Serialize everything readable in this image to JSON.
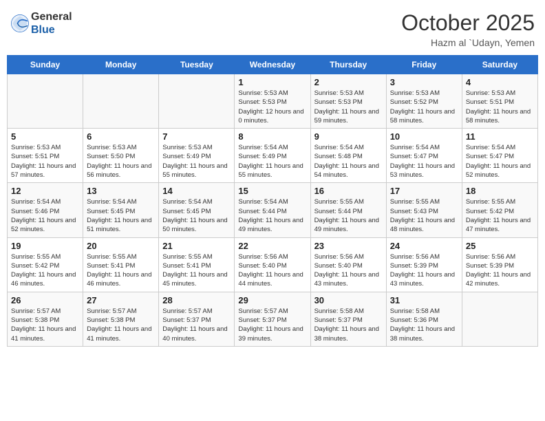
{
  "header": {
    "logo_general": "General",
    "logo_blue": "Blue",
    "month_title": "October 2025",
    "location": "Hazm al `Udayn, Yemen"
  },
  "weekdays": [
    "Sunday",
    "Monday",
    "Tuesday",
    "Wednesday",
    "Thursday",
    "Friday",
    "Saturday"
  ],
  "weeks": [
    [
      {
        "day": "",
        "sunrise": "",
        "sunset": "",
        "daylight": ""
      },
      {
        "day": "",
        "sunrise": "",
        "sunset": "",
        "daylight": ""
      },
      {
        "day": "",
        "sunrise": "",
        "sunset": "",
        "daylight": ""
      },
      {
        "day": "1",
        "sunrise": "Sunrise: 5:53 AM",
        "sunset": "Sunset: 5:53 PM",
        "daylight": "Daylight: 12 hours and 0 minutes."
      },
      {
        "day": "2",
        "sunrise": "Sunrise: 5:53 AM",
        "sunset": "Sunset: 5:53 PM",
        "daylight": "Daylight: 11 hours and 59 minutes."
      },
      {
        "day": "3",
        "sunrise": "Sunrise: 5:53 AM",
        "sunset": "Sunset: 5:52 PM",
        "daylight": "Daylight: 11 hours and 58 minutes."
      },
      {
        "day": "4",
        "sunrise": "Sunrise: 5:53 AM",
        "sunset": "Sunset: 5:51 PM",
        "daylight": "Daylight: 11 hours and 58 minutes."
      }
    ],
    [
      {
        "day": "5",
        "sunrise": "Sunrise: 5:53 AM",
        "sunset": "Sunset: 5:51 PM",
        "daylight": "Daylight: 11 hours and 57 minutes."
      },
      {
        "day": "6",
        "sunrise": "Sunrise: 5:53 AM",
        "sunset": "Sunset: 5:50 PM",
        "daylight": "Daylight: 11 hours and 56 minutes."
      },
      {
        "day": "7",
        "sunrise": "Sunrise: 5:53 AM",
        "sunset": "Sunset: 5:49 PM",
        "daylight": "Daylight: 11 hours and 55 minutes."
      },
      {
        "day": "8",
        "sunrise": "Sunrise: 5:54 AM",
        "sunset": "Sunset: 5:49 PM",
        "daylight": "Daylight: 11 hours and 55 minutes."
      },
      {
        "day": "9",
        "sunrise": "Sunrise: 5:54 AM",
        "sunset": "Sunset: 5:48 PM",
        "daylight": "Daylight: 11 hours and 54 minutes."
      },
      {
        "day": "10",
        "sunrise": "Sunrise: 5:54 AM",
        "sunset": "Sunset: 5:47 PM",
        "daylight": "Daylight: 11 hours and 53 minutes."
      },
      {
        "day": "11",
        "sunrise": "Sunrise: 5:54 AM",
        "sunset": "Sunset: 5:47 PM",
        "daylight": "Daylight: 11 hours and 52 minutes."
      }
    ],
    [
      {
        "day": "12",
        "sunrise": "Sunrise: 5:54 AM",
        "sunset": "Sunset: 5:46 PM",
        "daylight": "Daylight: 11 hours and 52 minutes."
      },
      {
        "day": "13",
        "sunrise": "Sunrise: 5:54 AM",
        "sunset": "Sunset: 5:45 PM",
        "daylight": "Daylight: 11 hours and 51 minutes."
      },
      {
        "day": "14",
        "sunrise": "Sunrise: 5:54 AM",
        "sunset": "Sunset: 5:45 PM",
        "daylight": "Daylight: 11 hours and 50 minutes."
      },
      {
        "day": "15",
        "sunrise": "Sunrise: 5:54 AM",
        "sunset": "Sunset: 5:44 PM",
        "daylight": "Daylight: 11 hours and 49 minutes."
      },
      {
        "day": "16",
        "sunrise": "Sunrise: 5:55 AM",
        "sunset": "Sunset: 5:44 PM",
        "daylight": "Daylight: 11 hours and 49 minutes."
      },
      {
        "day": "17",
        "sunrise": "Sunrise: 5:55 AM",
        "sunset": "Sunset: 5:43 PM",
        "daylight": "Daylight: 11 hours and 48 minutes."
      },
      {
        "day": "18",
        "sunrise": "Sunrise: 5:55 AM",
        "sunset": "Sunset: 5:42 PM",
        "daylight": "Daylight: 11 hours and 47 minutes."
      }
    ],
    [
      {
        "day": "19",
        "sunrise": "Sunrise: 5:55 AM",
        "sunset": "Sunset: 5:42 PM",
        "daylight": "Daylight: 11 hours and 46 minutes."
      },
      {
        "day": "20",
        "sunrise": "Sunrise: 5:55 AM",
        "sunset": "Sunset: 5:41 PM",
        "daylight": "Daylight: 11 hours and 46 minutes."
      },
      {
        "day": "21",
        "sunrise": "Sunrise: 5:55 AM",
        "sunset": "Sunset: 5:41 PM",
        "daylight": "Daylight: 11 hours and 45 minutes."
      },
      {
        "day": "22",
        "sunrise": "Sunrise: 5:56 AM",
        "sunset": "Sunset: 5:40 PM",
        "daylight": "Daylight: 11 hours and 44 minutes."
      },
      {
        "day": "23",
        "sunrise": "Sunrise: 5:56 AM",
        "sunset": "Sunset: 5:40 PM",
        "daylight": "Daylight: 11 hours and 43 minutes."
      },
      {
        "day": "24",
        "sunrise": "Sunrise: 5:56 AM",
        "sunset": "Sunset: 5:39 PM",
        "daylight": "Daylight: 11 hours and 43 minutes."
      },
      {
        "day": "25",
        "sunrise": "Sunrise: 5:56 AM",
        "sunset": "Sunset: 5:39 PM",
        "daylight": "Daylight: 11 hours and 42 minutes."
      }
    ],
    [
      {
        "day": "26",
        "sunrise": "Sunrise: 5:57 AM",
        "sunset": "Sunset: 5:38 PM",
        "daylight": "Daylight: 11 hours and 41 minutes."
      },
      {
        "day": "27",
        "sunrise": "Sunrise: 5:57 AM",
        "sunset": "Sunset: 5:38 PM",
        "daylight": "Daylight: 11 hours and 41 minutes."
      },
      {
        "day": "28",
        "sunrise": "Sunrise: 5:57 AM",
        "sunset": "Sunset: 5:37 PM",
        "daylight": "Daylight: 11 hours and 40 minutes."
      },
      {
        "day": "29",
        "sunrise": "Sunrise: 5:57 AM",
        "sunset": "Sunset: 5:37 PM",
        "daylight": "Daylight: 11 hours and 39 minutes."
      },
      {
        "day": "30",
        "sunrise": "Sunrise: 5:58 AM",
        "sunset": "Sunset: 5:37 PM",
        "daylight": "Daylight: 11 hours and 38 minutes."
      },
      {
        "day": "31",
        "sunrise": "Sunrise: 5:58 AM",
        "sunset": "Sunset: 5:36 PM",
        "daylight": "Daylight: 11 hours and 38 minutes."
      },
      {
        "day": "",
        "sunrise": "",
        "sunset": "",
        "daylight": ""
      }
    ]
  ]
}
